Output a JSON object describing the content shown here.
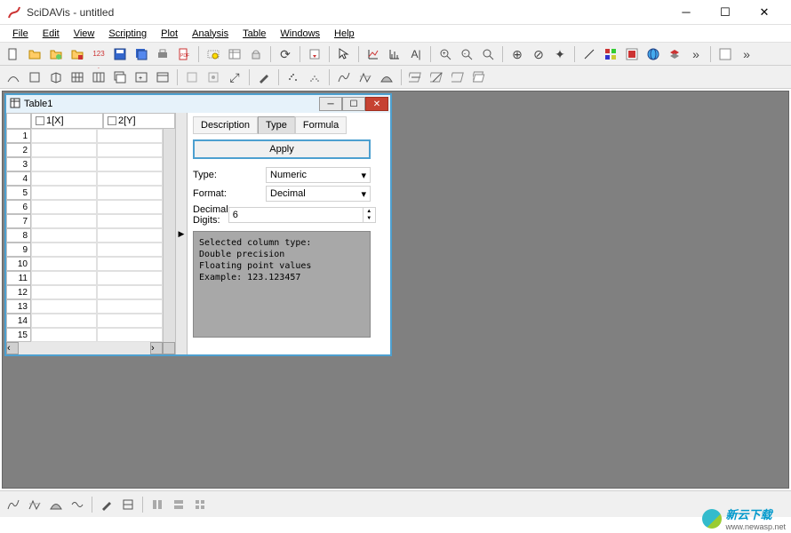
{
  "app": {
    "icon": "scidavis-icon",
    "title": "SciDAVis - untitled"
  },
  "menu": [
    "File",
    "Edit",
    "View",
    "Scripting",
    "Plot",
    "Analysis",
    "Table",
    "Windows",
    "Help"
  ],
  "toolbar1": [
    "new-file",
    "open-folder",
    "open-project",
    "open-aux",
    "template",
    "save",
    "save-all",
    "print",
    "pdf",
    "sep",
    "select-region",
    "table-window",
    "lock",
    "sep",
    "refresh",
    "sep",
    "export",
    "sep",
    "pointer",
    "sep",
    "graph",
    "bars",
    "text-a",
    "sep",
    "zoom-in",
    "zoom-out",
    "zoom-fit",
    "sep",
    "add-h",
    "add-v",
    "add-star",
    "sep",
    "line-tool",
    "palette",
    "color",
    "globe",
    "layers",
    "more",
    "sep",
    "prefs",
    "more2"
  ],
  "toolbar2": [
    "curve",
    "box",
    "box3d",
    "grid",
    "grid-multi",
    "grid-stack",
    "grid-insert",
    "grid-merge",
    "sep",
    "unlink",
    "link",
    "expand",
    "sep",
    "wizard",
    "sep",
    "scatter",
    "density",
    "sep",
    "curve-fit",
    "curve-peak",
    "curve-area",
    "sep",
    "layer-h",
    "layer-slash",
    "layer-empty",
    "layers-stack"
  ],
  "table_window": {
    "title": "Table1",
    "columns": [
      "1[X]",
      "2[Y]"
    ],
    "rows": [
      "1",
      "2",
      "3",
      "4",
      "5",
      "6",
      "7",
      "8",
      "9",
      "10",
      "11",
      "12",
      "13",
      "14",
      "15"
    ]
  },
  "properties": {
    "tabs": {
      "desc": "Description",
      "type": "Type",
      "formula": "Formula"
    },
    "apply_label": "Apply",
    "type_label": "Type:",
    "type_value": "Numeric",
    "format_label": "Format:",
    "format_value": "Decimal",
    "digits_label": "Decimal Digits:",
    "digits_value": "6",
    "info": {
      "l1": "Selected column type:",
      "l2": "Double precision",
      "l3": "Floating point values",
      "l4": "Example: 123.123457"
    }
  },
  "bottom_toolbar": [
    "curve-fit",
    "curve-peak",
    "curve-area",
    "curve-smooth",
    "sep",
    "wizard",
    "wizard2",
    "sep",
    "layout1",
    "layout2",
    "layout3"
  ],
  "watermark": {
    "text": "新云下载",
    "sub": "www.newasp.net"
  }
}
